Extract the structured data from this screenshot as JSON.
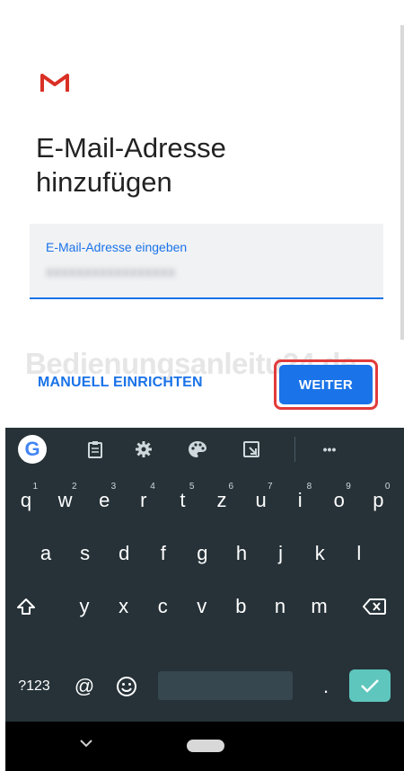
{
  "app": {
    "title": "E-Mail-Adresse hinzufügen",
    "logo_icon": "gmail-m-icon",
    "brand_color": "#d93025",
    "accent_color": "#1a73e8"
  },
  "email_field": {
    "label": "E-Mail-Adresse eingeben",
    "value": "xxxxxxxxxxxxxxxxx"
  },
  "actions": {
    "manual_setup": "MANUELL EINRICHTEN",
    "next": "WEITER"
  },
  "watermark": "Bedienungsanleitu24.de",
  "keyboard": {
    "toolbar": [
      "google-g-icon",
      "clipboard-icon",
      "gear-icon",
      "palette-icon",
      "one-hand-icon",
      "more-icon"
    ],
    "google_label": "G",
    "more_label": "•••",
    "row1": [
      {
        "k": "q",
        "h": "1"
      },
      {
        "k": "w",
        "h": "2"
      },
      {
        "k": "e",
        "h": "3"
      },
      {
        "k": "r",
        "h": "4"
      },
      {
        "k": "t",
        "h": "5"
      },
      {
        "k": "z",
        "h": "6"
      },
      {
        "k": "u",
        "h": "7"
      },
      {
        "k": "i",
        "h": "8"
      },
      {
        "k": "o",
        "h": "9"
      },
      {
        "k": "p",
        "h": "0"
      }
    ],
    "row2": [
      "a",
      "s",
      "d",
      "f",
      "g",
      "h",
      "j",
      "k",
      "l"
    ],
    "row3": [
      "y",
      "x",
      "c",
      "v",
      "b",
      "n",
      "m"
    ],
    "symbols_label": "?123",
    "at_label": "@",
    "period_label": "."
  }
}
